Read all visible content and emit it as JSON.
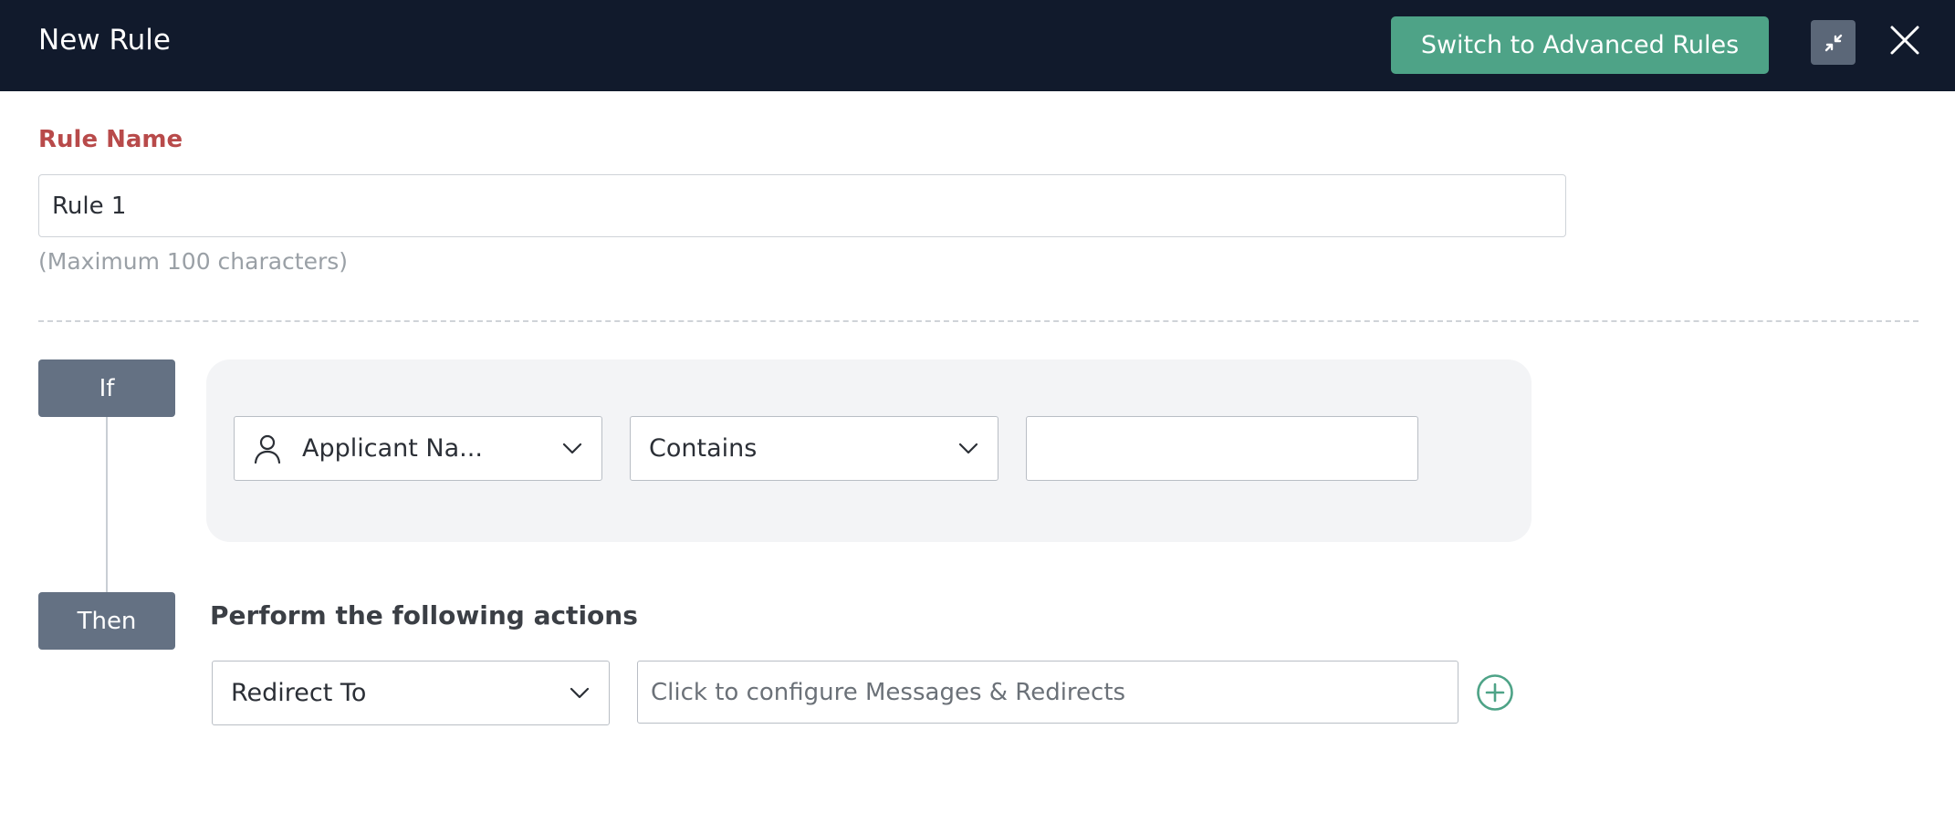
{
  "header": {
    "title": "New Rule",
    "advanced_button_label": "Switch to Advanced Rules",
    "minimize_icon": "collapse-arrows-icon",
    "close_icon": "close-icon"
  },
  "rule_name": {
    "label": "Rule Name",
    "value": "Rule 1",
    "hint": "(Maximum 100 characters)"
  },
  "condition": {
    "tag": "If",
    "field": {
      "icon": "person-icon",
      "value": "Applicant Na..."
    },
    "operator": "Contains",
    "value": ""
  },
  "action": {
    "tag": "Then",
    "title": "Perform the following actions",
    "type": "Redirect To",
    "placeholder": "Click to configure Messages & Redirects",
    "add_icon": "plus-circle-icon"
  },
  "colors": {
    "header_bg": "#111a2c",
    "accent": "#4ea387",
    "label_red": "#b84a4a",
    "tag_bg": "#647183"
  }
}
